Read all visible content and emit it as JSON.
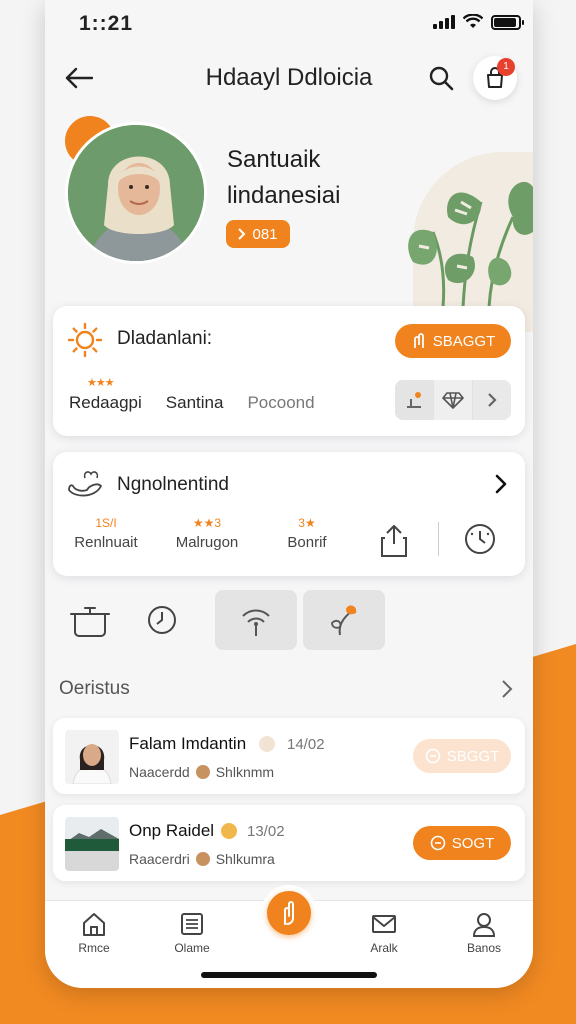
{
  "status": {
    "time": "1::21"
  },
  "header": {
    "title": "Hdaayl Ddloicia",
    "cart_badge": "1"
  },
  "profile": {
    "name_line1": "Santuaik",
    "name_line2": "lindanesiai",
    "tag_label": "081",
    "accent_color": "#f0831d"
  },
  "card1": {
    "title": "Dladanlani:",
    "action_label": "SBAGGT",
    "stars": "★★★",
    "stats": [
      "Redaagpi",
      "Santina",
      "Pocoond"
    ]
  },
  "card2": {
    "title": "Ngnolnentind",
    "stats": [
      {
        "top": "1S/I",
        "label": "Renlnuait"
      },
      {
        "top": "★★3",
        "label": "Malrugon"
      },
      {
        "top": "3★",
        "label": "Bonrif"
      }
    ]
  },
  "section": {
    "title": "Oeristus"
  },
  "list": [
    {
      "title": "Falam Imdantin",
      "date": "14/02",
      "sub1": "Naacerdd",
      "sub2": "Shlknmm",
      "button": "SBGGT",
      "button_enabled": false
    },
    {
      "title": "Onp Raidel",
      "date": "13/02",
      "sub1": "Raacerdri",
      "sub2": "Shlkumra",
      "button": "SOGT",
      "button_enabled": true
    }
  ],
  "tabbar": {
    "tabs": [
      {
        "label": "Rmce",
        "icon": "home-icon"
      },
      {
        "label": "Olame",
        "icon": "list-icon"
      },
      {
        "label": "Aralk",
        "icon": "mail-icon"
      },
      {
        "label": "Banos",
        "icon": "user-icon"
      }
    ]
  }
}
